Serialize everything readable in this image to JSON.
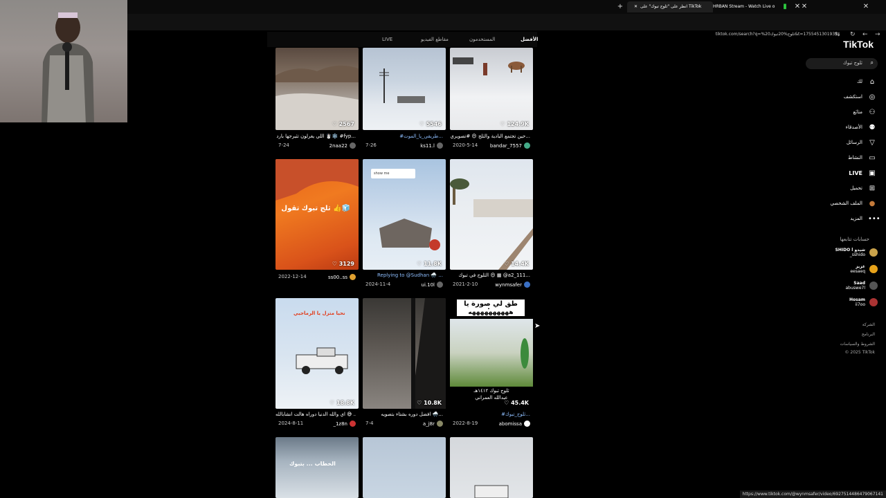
{
  "browser": {
    "tabs": [
      {
        "label": "انظر على \"ثلوج تبوك\" على TikTok",
        "active": true
      },
      {
        "label": "HRBAN Stream - Watch Live o",
        "active": false
      }
    ],
    "new_tab_label": "+",
    "url": "tiktok.com/search?q=%20ثلوج%20تبوك&t=1755451301935",
    "status_url": "https://www.tiktok.com/@wynmsafer/video/6927514486479067141"
  },
  "tiktok": {
    "logo": "TikTok",
    "search_placeholder": "ثلوج تبوك",
    "nav": [
      {
        "label": "لك",
        "icon": "home-icon"
      },
      {
        "label": "استكشف",
        "icon": "compass-icon"
      },
      {
        "label": "متابَع",
        "icon": "user-plus-icon"
      },
      {
        "label": "الأصدقاء",
        "icon": "friends-icon"
      },
      {
        "label": "الرسائل",
        "icon": "send-icon"
      },
      {
        "label": "النشاط",
        "icon": "message-icon"
      },
      {
        "label": "LIVE",
        "icon": "live-icon"
      },
      {
        "label": "تحميل",
        "icon": "upload-icon"
      },
      {
        "label": "الملف الشخصي",
        "icon": "avatar"
      },
      {
        "label": "المزيد",
        "icon": "more-icon"
      }
    ],
    "following_title": "حسابات تتابعها",
    "following": [
      {
        "name": "SHIDO l شيدو",
        "handle": "_sshido"
      },
      {
        "name": "غزيز",
        "handle": "eesaeq"
      },
      {
        "name": "Saad",
        "handle": "abuswe7l"
      },
      {
        "name": "Hosam",
        "handle": "ii7oo"
      }
    ],
    "footer": [
      "الشركة",
      "البرنامج",
      "الشروط والسياسات",
      "© 2025 TikTok"
    ]
  },
  "result_tabs": [
    "الأفضل",
    "المستخدمون",
    "مقاطع الفيديو",
    "LIVE"
  ],
  "videos": [
    {
      "likes": "124.9K",
      "caption": "حين تجتمع البادية والثلج 😍 #تصويري...",
      "date": "2020-5-14",
      "user": "bandar_7557"
    },
    {
      "likes": "5546",
      "caption": "#طريقي_يا_الموت...",
      "date": "7-26",
      "user": "ks11.l"
    },
    {
      "likes": "2567",
      "caption": "اللي يغرلون تثيرجها بارد ☃️❄️ #fyp...",
      "date": "7-24",
      "user": "2naa22"
    },
    {
      "likes": "14.4K",
      "caption": "الثلوج في تبوك 😍 ▦ @a2_111...",
      "date": "2021-2-10",
      "user": "wynmsafer"
    },
    {
      "likes": "11.8K",
      "caption": "Replying to @Sudhan 🌨️ ...",
      "date": "2024-11-4",
      "user": "ui.10l"
    },
    {
      "likes": "3129",
      "caption": "",
      "date": "2022-12-14",
      "user": "ss00..ss"
    },
    {
      "likes": "45.4K",
      "caption": "#ثلوج_تبوك...",
      "date": "2022-8-19",
      "user": "abomissa"
    },
    {
      "likes": "10.8K",
      "caption": "افضل دوره بشتاء بتصويه 🌨️...",
      "date": "7-4",
      "user": "a_j8r"
    },
    {
      "likes": "18.8K",
      "caption": "اي والله الدنيا دوراه هالت انشابالله 😅 ...",
      "date": "2024-8-11",
      "user": "_1z8n"
    },
    {
      "likes": "",
      "caption": "",
      "date": "",
      "user": ""
    },
    {
      "likes": "",
      "caption": "",
      "date": "",
      "user": ""
    },
    {
      "likes": "",
      "caption": "",
      "date": "",
      "user": ""
    }
  ],
  "overlays": {
    "v6": "ثلج تبوك تقول 👍🧊",
    "v5_reply": "show me",
    "v7_top": "طق لي صورة يا عيل",
    "v7_top2": "ههههههههههه",
    "v7_bottom": "ثلوج تبوك ١٤١٢هـ",
    "v7_bottom2": "عبدالله العمراني",
    "v9": "نحيا متزل يا الرماجيي",
    "v10": "الخطاب ... بتبوك"
  }
}
